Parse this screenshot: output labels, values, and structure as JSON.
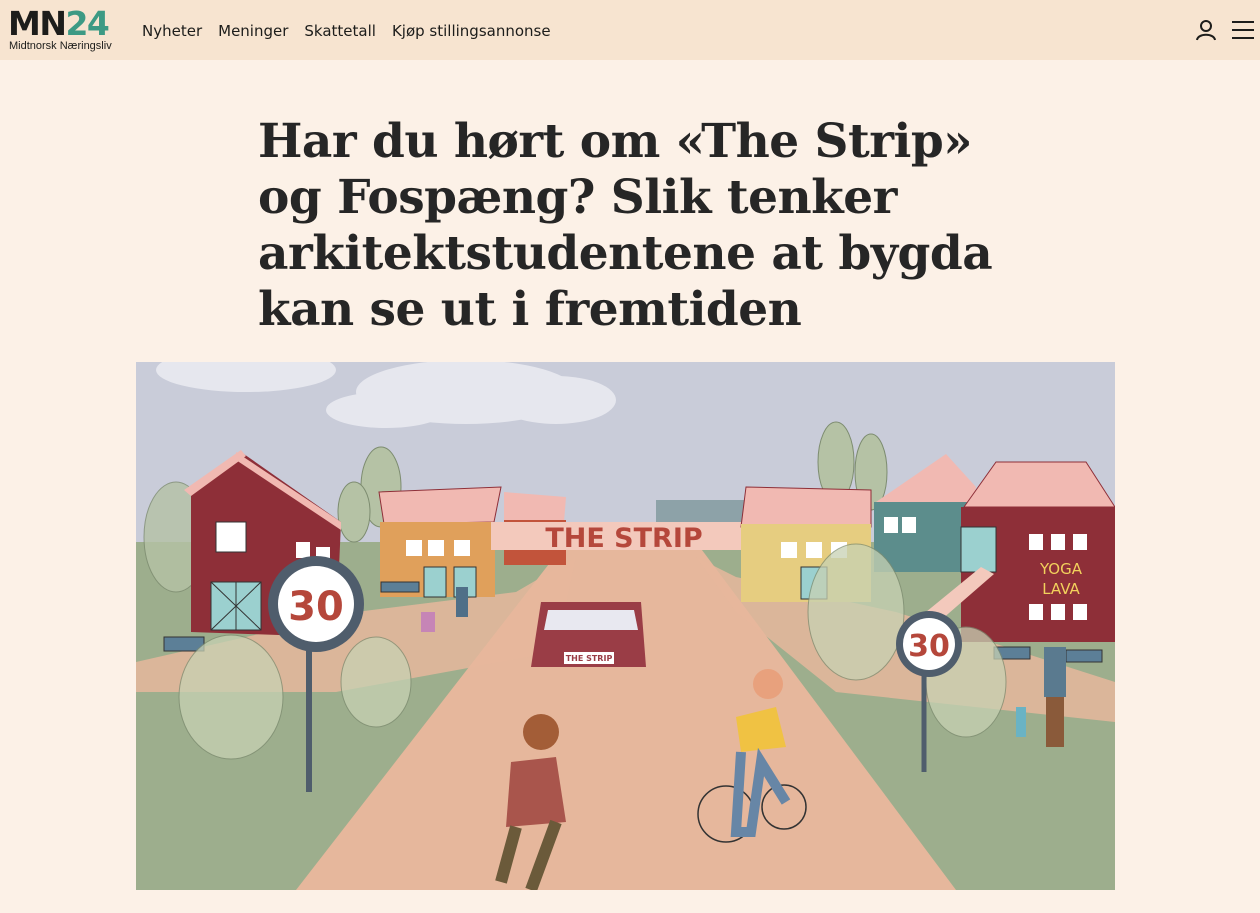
{
  "header": {
    "logo": {
      "main_a": "MN",
      "main_b": "24",
      "subtitle": "Midtnorsk Næringsliv"
    },
    "nav": [
      {
        "label": "Nyheter"
      },
      {
        "label": "Meninger"
      },
      {
        "label": "Skattetall"
      },
      {
        "label": "Kjøp stillingsannonse"
      }
    ],
    "icons": {
      "user": "user-icon",
      "menu": "hamburger-menu-icon"
    }
  },
  "article": {
    "headline": "Har du hørt om «The Strip» og Fospæng? Slik tenker arkitektstudentene at bygda kan se ut i fremtiden"
  },
  "illustration": {
    "banner_text": "THE STRIP",
    "plate_text": "THE STRIP",
    "speed_sign_left": "30",
    "speed_sign_right": "30",
    "shop_sign_line1": "YOGA",
    "shop_sign_line2": "LAVA"
  },
  "colors": {
    "topbar": "#f7e4d0",
    "background": "#fcf1e7",
    "logo_accent": "#3d9a84",
    "sky": "#c9ccd9",
    "road": "#e6b79c",
    "grass": "#9dae8d"
  }
}
